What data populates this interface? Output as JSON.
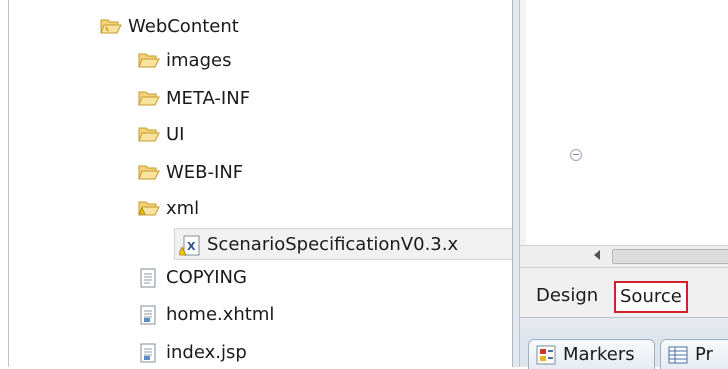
{
  "tree": {
    "items": [
      {
        "label": "WebContent",
        "icon": "folder-open-icon"
      },
      {
        "label": "images",
        "icon": "folder-icon"
      },
      {
        "label": "META-INF",
        "icon": "folder-icon"
      },
      {
        "label": "UI",
        "icon": "folder-icon"
      },
      {
        "label": "WEB-INF",
        "icon": "folder-icon"
      },
      {
        "label": "xml",
        "icon": "folder-warning-icon"
      },
      {
        "label": "ScenarioSpecificationV0.3.x",
        "icon": "xml-file-warning-icon",
        "selected": true
      },
      {
        "label": "COPYING",
        "icon": "text-file-icon"
      },
      {
        "label": "home.xhtml",
        "icon": "html-file-icon"
      },
      {
        "label": "index.jsp",
        "icon": "jsp-file-icon"
      }
    ]
  },
  "editor": {
    "tabs": {
      "design": "Design",
      "source": "Source"
    },
    "active_tab": "Source",
    "highlight_color": "#d0202a"
  },
  "views": {
    "markers": "Markers",
    "properties": "Pr"
  }
}
